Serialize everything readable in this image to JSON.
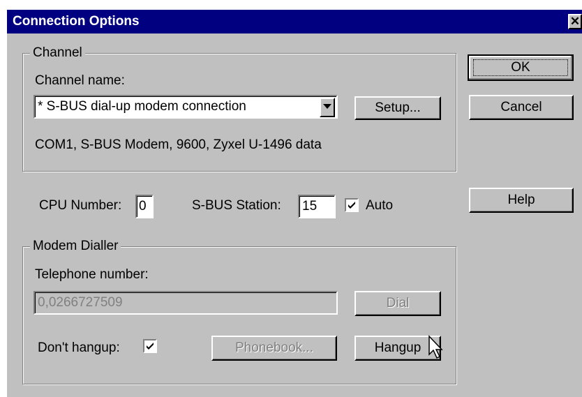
{
  "window": {
    "title": "Connection Options",
    "close_glyph": "✕"
  },
  "buttons": {
    "ok": "OK",
    "cancel": "Cancel",
    "help": "Help",
    "setup": "Setup...",
    "dial": "Dial",
    "phonebook": "Phonebook...",
    "hangup": "Hangup"
  },
  "channel": {
    "legend": "Channel",
    "name_label": "Channel name:",
    "selected": "* S-BUS dial-up modem connection",
    "info": "COM1, S-BUS Modem, 9600, Zyxel U-1496 data"
  },
  "cpu": {
    "label": "CPU Number:",
    "value": "0"
  },
  "station": {
    "label": "S-BUS Station:",
    "value": "15",
    "auto_label": "Auto",
    "auto_checked": true
  },
  "modem": {
    "legend": "Modem Dialler",
    "telephone_label": "Telephone number:",
    "telephone_value": "0,0266727509",
    "dont_hangup_label": "Don't hangup:",
    "dont_hangup_checked": true
  },
  "icons": {
    "close": "close-icon",
    "dropdown": "chevron-down-icon",
    "check": "check-icon",
    "cursor": "mouse-pointer-icon"
  },
  "colors": {
    "titlebar": "#000080",
    "face": "#c0c0c0",
    "disabled_text": "#808080"
  }
}
